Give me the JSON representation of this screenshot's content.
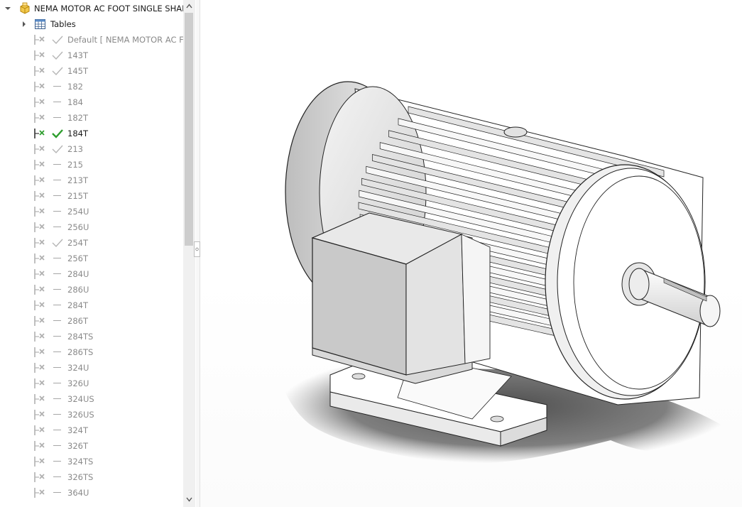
{
  "tree": {
    "root_label": "NEMA MOTOR AC FOOT SINGLE SHAFT",
    "tables_label": "Tables",
    "configurations": [
      {
        "label": "Default [ NEMA MOTOR AC FO",
        "mark": "check"
      },
      {
        "label": "143T",
        "mark": "check"
      },
      {
        "label": "145T",
        "mark": "check"
      },
      {
        "label": "182",
        "mark": "dash"
      },
      {
        "label": "184",
        "mark": "dash"
      },
      {
        "label": "182T",
        "mark": "dash"
      },
      {
        "label": "184T",
        "mark": "check-active",
        "active": true
      },
      {
        "label": "213",
        "mark": "check"
      },
      {
        "label": "215",
        "mark": "dash"
      },
      {
        "label": "213T",
        "mark": "dash"
      },
      {
        "label": "215T",
        "mark": "dash"
      },
      {
        "label": "254U",
        "mark": "dash"
      },
      {
        "label": "256U",
        "mark": "dash"
      },
      {
        "label": "254T",
        "mark": "check"
      },
      {
        "label": "256T",
        "mark": "dash"
      },
      {
        "label": "284U",
        "mark": "dash"
      },
      {
        "label": "286U",
        "mark": "dash"
      },
      {
        "label": "284T",
        "mark": "dash"
      },
      {
        "label": "286T",
        "mark": "dash"
      },
      {
        "label": "284TS",
        "mark": "dash"
      },
      {
        "label": "286TS",
        "mark": "dash"
      },
      {
        "label": "324U",
        "mark": "dash"
      },
      {
        "label": "326U",
        "mark": "dash"
      },
      {
        "label": "324US",
        "mark": "dash"
      },
      {
        "label": "326US",
        "mark": "dash"
      },
      {
        "label": "324T",
        "mark": "dash"
      },
      {
        "label": "326T",
        "mark": "dash"
      },
      {
        "label": "324TS",
        "mark": "dash"
      },
      {
        "label": "326TS",
        "mark": "dash"
      },
      {
        "label": "364U",
        "mark": "dash"
      }
    ]
  },
  "icons": {
    "root": "part-icon",
    "tables": "table-icon",
    "configuration": "configuration-icon",
    "expand": "chevron-right-icon",
    "collapse": "chevron-down-icon"
  },
  "colors": {
    "active_check": "#2e9e2e",
    "inactive_check": "#b5b5b5",
    "active_text": "#1a1a1a",
    "inactive_text": "#8a8a8a"
  }
}
